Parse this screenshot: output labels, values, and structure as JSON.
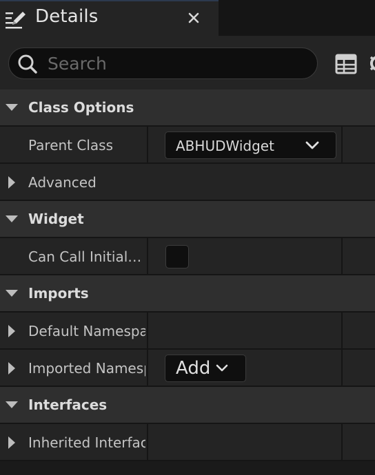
{
  "tab": {
    "title": "Details",
    "icon": "edit-details-icon",
    "close": "close-icon"
  },
  "search": {
    "placeholder": "Search",
    "value": ""
  },
  "toolbar": {
    "view_options_icon": "table-view-icon",
    "settings_icon": "gear-icon"
  },
  "categories": {
    "class_options": {
      "label": "Class Options"
    },
    "widget": {
      "label": "Widget"
    },
    "imports": {
      "label": "Imports"
    },
    "interfaces": {
      "label": "Interfaces"
    }
  },
  "properties": {
    "parent_class": {
      "label": "Parent Class",
      "value": "ABHUDWidget"
    },
    "advanced": {
      "label": "Advanced"
    },
    "can_call_initialized": {
      "label": "Can Call Initialized Without Player Context",
      "checked": false
    },
    "default_namespaces": {
      "label": "Default Namespaces"
    },
    "imported_namespaces": {
      "label": "Imported Namespaces",
      "add_label": "Add"
    },
    "inherited_interfaces": {
      "label": "Inherited Interfaces"
    }
  },
  "colors": {
    "panel": "#242424",
    "category": "#2f2f2f",
    "input": "#0f0f0f",
    "text": "#c4c4c4"
  }
}
